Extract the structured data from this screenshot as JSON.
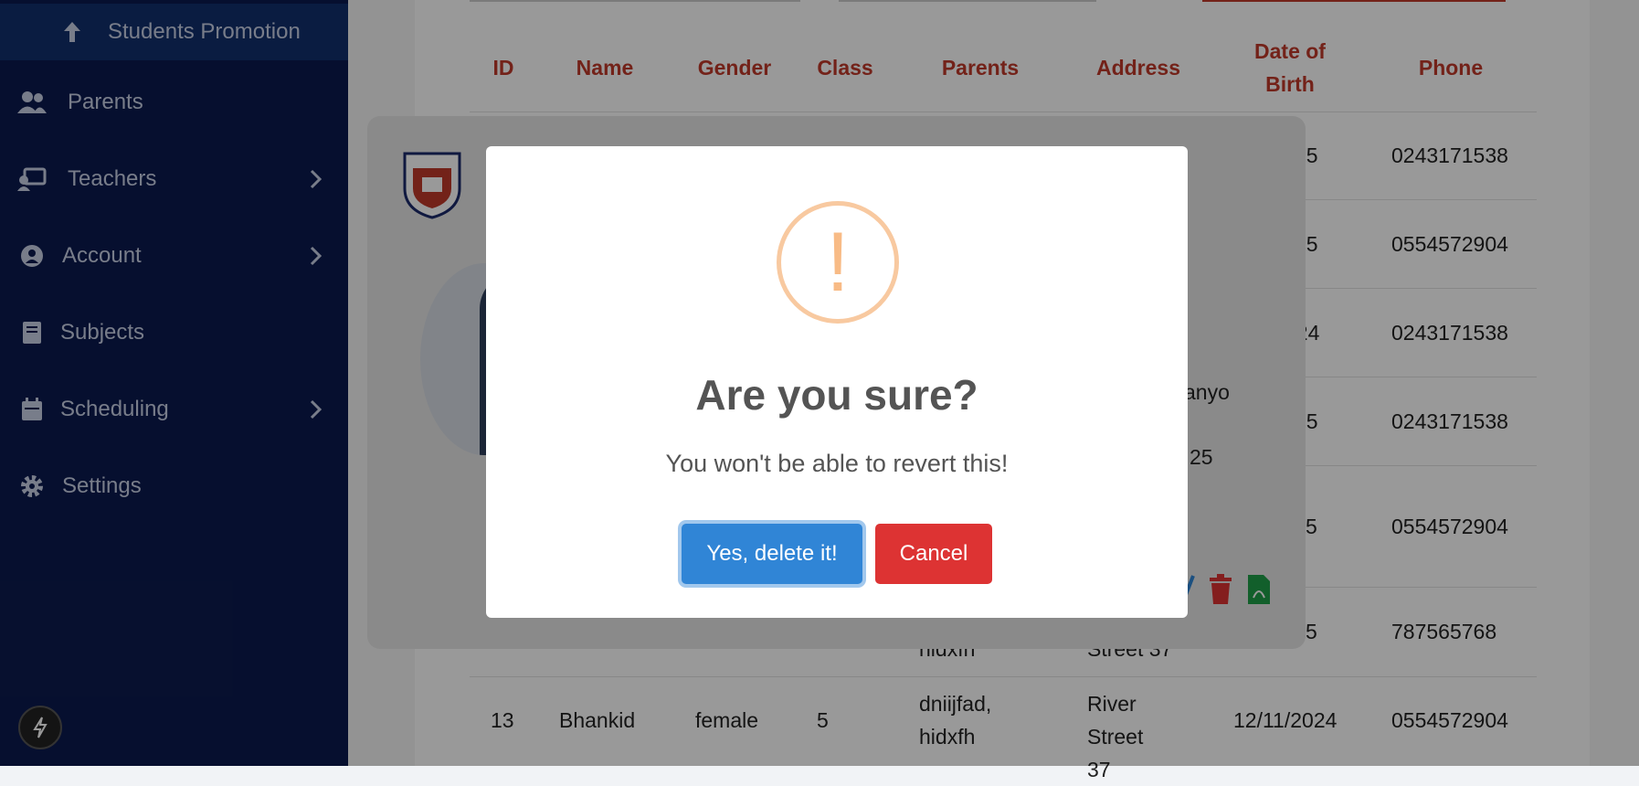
{
  "sidebar": {
    "items": [
      {
        "label": "Students Promotion",
        "icon": "arrow-up-icon"
      },
      {
        "label": "Parents",
        "icon": "users-icon"
      },
      {
        "label": "Teachers",
        "icon": "chalkboard-teacher-icon"
      },
      {
        "label": "Account",
        "icon": "user-circle-icon"
      },
      {
        "label": "Subjects",
        "icon": "book-icon"
      },
      {
        "label": "Scheduling",
        "icon": "calendar-icon"
      },
      {
        "label": "Settings",
        "icon": "gear-icon"
      }
    ]
  },
  "table": {
    "headers": [
      "ID",
      "Name",
      "Gender",
      "Class",
      "Parents",
      "Address",
      "Date of Birth",
      "Phone"
    ],
    "visible_dob_fragments": [
      "25",
      "25",
      "024",
      "25",
      "5",
      "5"
    ],
    "phones": [
      "0243171538",
      "0554572904",
      "0243171538",
      "0243171538",
      "0554572904",
      "787565768",
      "0554572904"
    ],
    "partial_row": {
      "parents": "hidxfh",
      "address": "Street 37"
    },
    "last_row": {
      "id": "13",
      "name": "Bhankid",
      "gender": "female",
      "class": "5",
      "parents": "dniijfad, hidxfh",
      "address": "River Street 37",
      "dob": "12/11/2024",
      "phone": "0554572904"
    }
  },
  "card": {
    "address_fragment": "anyo",
    "dob_fragment": "25"
  },
  "dialog": {
    "icon": "!",
    "title": "Are you sure?",
    "text": "You won't be able to revert this!",
    "confirm_label": "Yes, delete it!",
    "cancel_label": "Cancel"
  },
  "colors": {
    "sidebar": "#0b1a4f",
    "header_text": "#c0392b",
    "confirm": "#3085d6",
    "cancel": "#dd3333",
    "warn": "#f8bb86"
  }
}
